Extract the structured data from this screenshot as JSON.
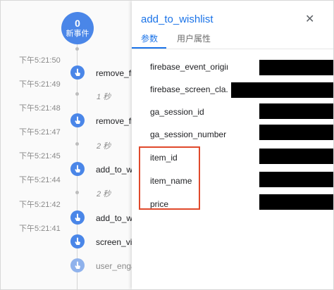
{
  "counter": {
    "count": "0",
    "label": "新事件"
  },
  "timeline": {
    "times": [
      "下午5:21:50",
      "下午5:21:49",
      "下午5:21:48",
      "下午5:21:47",
      "下午5:21:45",
      "下午5:21:44",
      "下午5:21:42",
      "下午5:21:41"
    ],
    "events": [
      {
        "name": "remove_fr"
      },
      {
        "name": "remove_fr"
      },
      {
        "name": "add_to_wi"
      },
      {
        "name": "add_to_wi"
      },
      {
        "name": "screen_vie"
      },
      {
        "name": "user_enga"
      }
    ],
    "gaps": [
      "1 秒",
      "2 秒",
      "2 秒"
    ]
  },
  "panel": {
    "title": "add_to_wishlist",
    "close_icon": "close-icon",
    "tabs": [
      {
        "label": "参数"
      },
      {
        "label": "用户属性"
      }
    ],
    "params": [
      {
        "key": "firebase_event_origin"
      },
      {
        "key": "firebase_screen_cla..."
      },
      {
        "key": "ga_session_id"
      },
      {
        "key": "ga_session_number"
      },
      {
        "key": "item_id"
      },
      {
        "key": "item_name"
      },
      {
        "key": "price"
      }
    ]
  },
  "colors": {
    "accent": "#1a73e8",
    "event_blue": "#4a86e8",
    "highlight": "#e0492b"
  }
}
